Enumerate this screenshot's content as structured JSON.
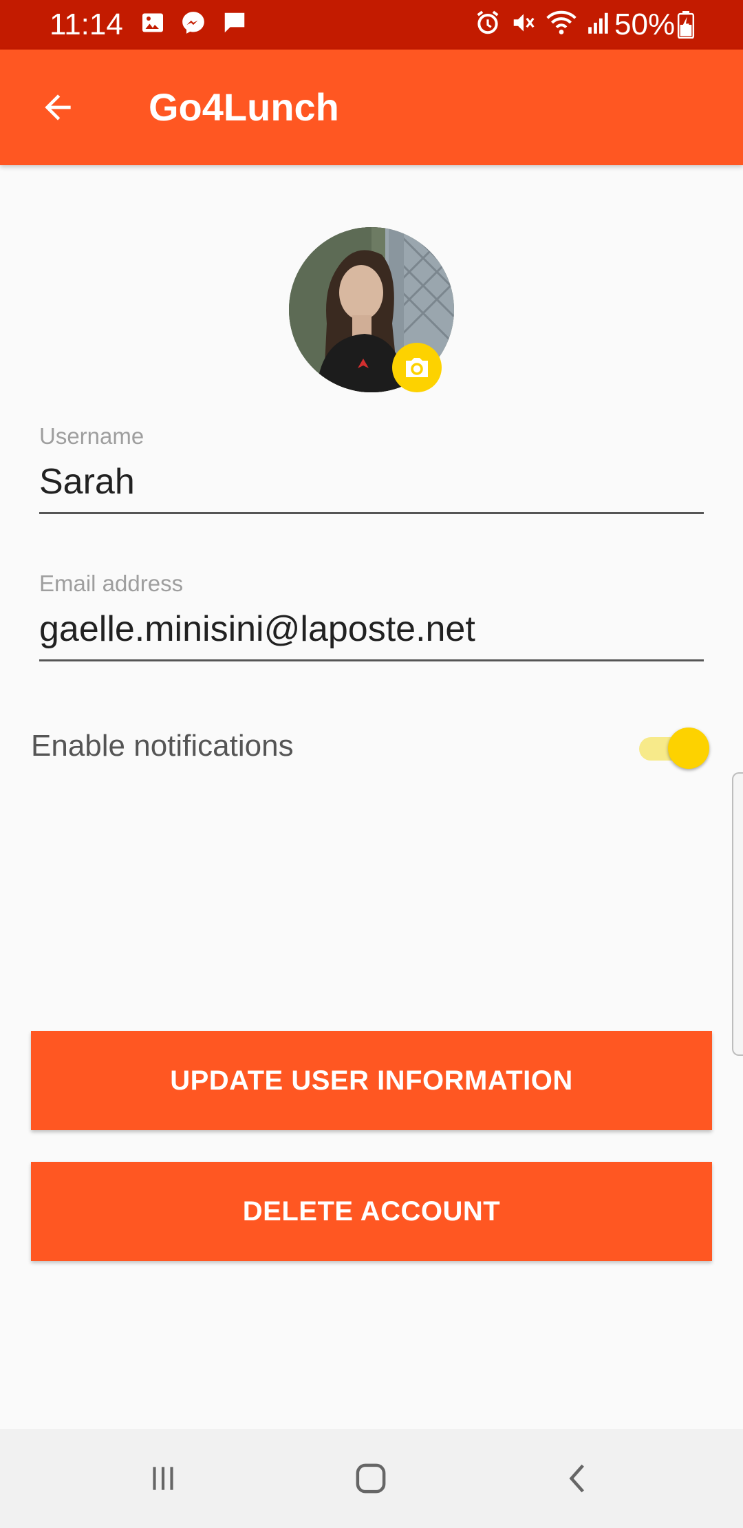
{
  "status_bar": {
    "time": "11:14",
    "battery": "50%",
    "left_icons": [
      "image-icon",
      "messenger-icon",
      "message-icon"
    ],
    "right_icons": [
      "alarm-icon",
      "mute-icon",
      "wifi-icon",
      "signal-icon",
      "battery-charging-icon"
    ]
  },
  "app_bar": {
    "title": "Go4Lunch",
    "back_icon": "arrow-back-icon"
  },
  "profile": {
    "avatar": "profile-photo",
    "camera_icon": "camera-icon"
  },
  "form": {
    "username_label": "Username",
    "username_value": "Sarah",
    "email_label": "Email address",
    "email_value": "gaelle.minisini@laposte.net"
  },
  "notifications": {
    "label": "Enable notifications",
    "enabled": true
  },
  "buttons": {
    "update_label": "UPDATE USER INFORMATION",
    "delete_label": "DELETE ACCOUNT"
  },
  "colors": {
    "status_bar": "#c31b00",
    "primary": "#ff5722",
    "accent": "#fdd200"
  },
  "nav_bar": {
    "icons": [
      "recents-icon",
      "home-icon",
      "back-icon"
    ]
  }
}
